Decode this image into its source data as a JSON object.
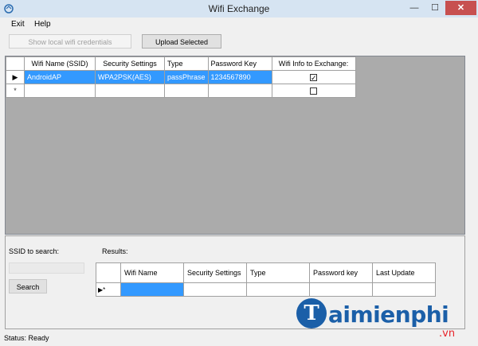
{
  "window": {
    "title": "Wifi Exchange",
    "minimize": "—",
    "maximize": "☐",
    "close": "✕"
  },
  "menu": {
    "items": [
      "Exit",
      "Help"
    ]
  },
  "toolbar": {
    "show_credentials": "Show local wifi credentials",
    "upload_selected": "Upload Selected"
  },
  "wifi_table": {
    "columns": [
      "Wifi Name (SSID)",
      "Security Settings",
      "Type",
      "Password Key",
      "Wifi Info to Exchange:"
    ],
    "rows": [
      {
        "marker": "▶",
        "ssid": "AndroidAP",
        "security": "WPA2PSK(AES)",
        "type": "passPhrase",
        "password": "1234567890",
        "exchange_checked": "✓"
      },
      {
        "marker": "*",
        "ssid": "",
        "security": "",
        "type": "",
        "password": "",
        "exchange_checked": ""
      }
    ]
  },
  "search": {
    "label": "SSID to search:",
    "value": "",
    "button": "Search"
  },
  "results": {
    "label": "Results:",
    "columns": [
      "Wifi Name",
      "Security Settings",
      "Type",
      "Password key",
      "Last Update"
    ],
    "row_marker": "▶*"
  },
  "status": {
    "text": "Status: Ready"
  },
  "watermark": {
    "letter": "T",
    "brand": "aimienphi",
    "tld": ".vn"
  }
}
